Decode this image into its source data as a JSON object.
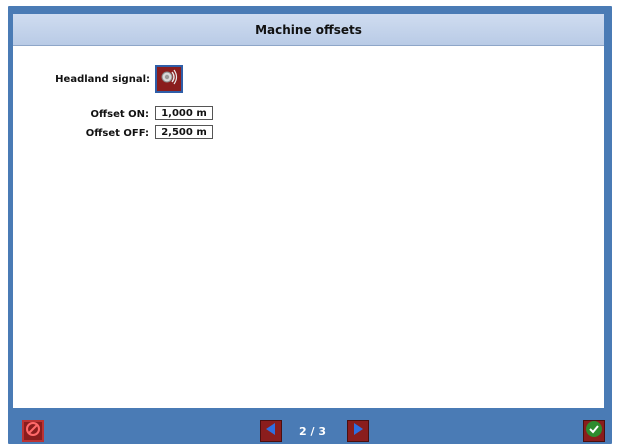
{
  "window": {
    "title": "Machine offsets"
  },
  "form": {
    "headland_label": "Headland signal:",
    "offset_on_label": "Offset ON:",
    "offset_on_value": "1,000 m",
    "offset_off_label": "Offset OFF:",
    "offset_off_value": "2,500 m"
  },
  "footer": {
    "page_indicator": "2 / 3"
  },
  "icons": {
    "headland": "speaker-sound-icon",
    "cancel": "prohibited-icon",
    "prev": "arrow-left-icon",
    "next": "arrow-right-icon",
    "confirm": "check-icon"
  },
  "colors": {
    "frame": "#4a7bb5",
    "button_red": "#8a1d1d",
    "confirm_green": "#2e8b2e"
  }
}
